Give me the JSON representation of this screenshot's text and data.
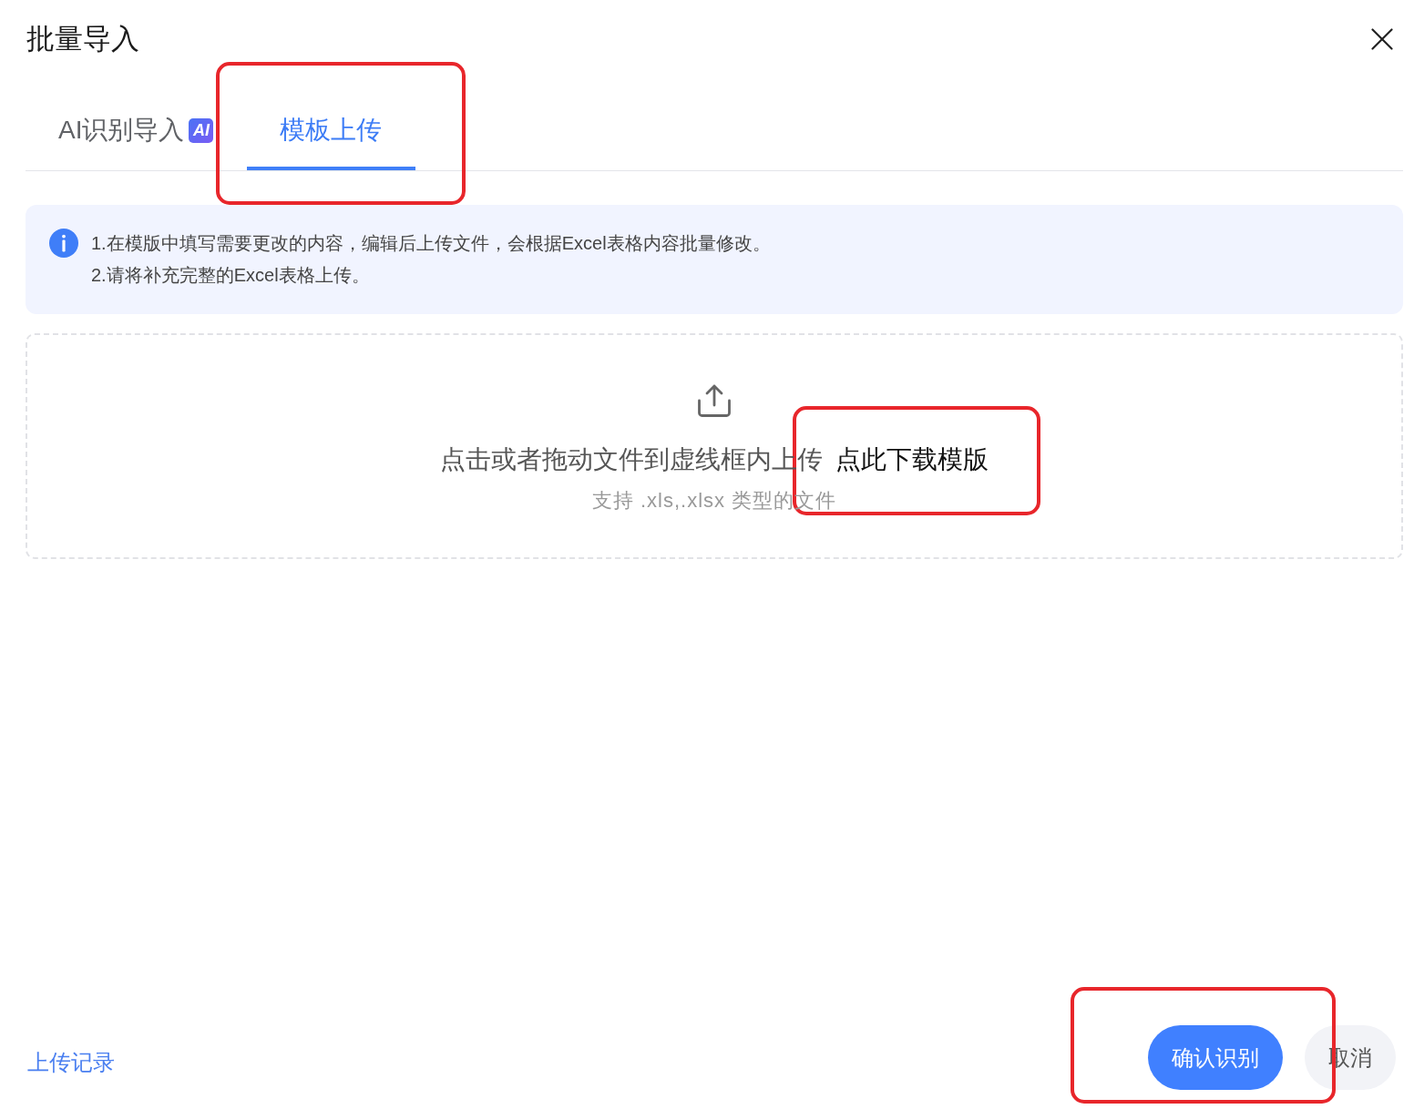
{
  "dialog": {
    "title": "批量导入"
  },
  "tabs": [
    {
      "label": "AI识别导入",
      "badge": "AI",
      "selected": false,
      "highlighted": false
    },
    {
      "label": "模板上传",
      "selected": true,
      "highlighted": true
    }
  ],
  "notice": {
    "lines": [
      "1.在模版中填写需要更改的内容，编辑后上传文件，会根据Excel表格内容批量修改。",
      "2.请将补充完整的Excel表格上传。"
    ]
  },
  "upload": {
    "prompt": "点击或者拖动文件到虚线框内上传",
    "link": {
      "label": "点此下载模版",
      "highlighted": true
    },
    "hint": "支持 .xls,.xlsx 类型的文件"
  },
  "footer": {
    "link": "上传记录",
    "buttons": [
      {
        "label": "确认识别",
        "kind": "primary",
        "highlighted": true
      },
      {
        "label": "取消",
        "kind": "secondary",
        "highlighted": false
      }
    ]
  }
}
